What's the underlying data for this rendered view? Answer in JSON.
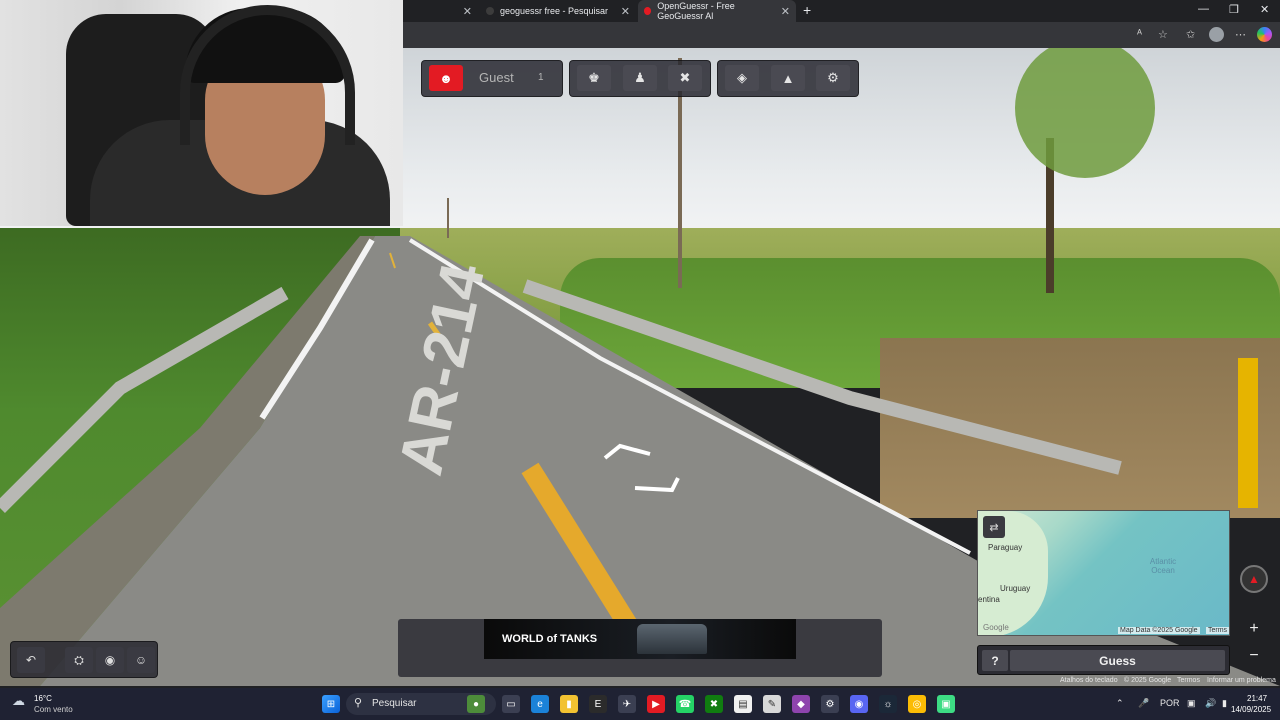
{
  "browser": {
    "tabs": [
      {
        "label": "",
        "close": "✕"
      },
      {
        "label": "geoguessr free - Pesquisar",
        "close": "✕"
      },
      {
        "label": "OpenGuessr - Free GeoGuessr Al",
        "close": "✕"
      }
    ],
    "new_tab": "+",
    "window_controls": {
      "minimize": "—",
      "maximize": "❐",
      "close": "✕"
    }
  },
  "game": {
    "player_name": "Guest",
    "player_count": "1",
    "guess_help": "?",
    "guess_label": "Guess",
    "road_marking": "AR-214",
    "map_labels": {
      "paraguay": "Paraguay",
      "uruguay": "Uruguay",
      "argentina": "entina",
      "ocean": "Atlantic Ocean",
      "attribution": "Map Data ©2025 Google",
      "terms": "Terms",
      "google": "Google"
    },
    "credits": {
      "shortcuts": "Atalhos do teclado",
      "data": "© 2025 Google",
      "terms": "Termos",
      "report": "Informar um problema"
    },
    "zoom_in": "+",
    "zoom_out": "−",
    "ad_label": "WORLD of TANKS"
  },
  "taskbar": {
    "weather_temp": "16°C",
    "weather_cond": "Com vento",
    "search_label": "Pesquisar",
    "language": "POR",
    "time": "21:47",
    "date": "14/09/2025"
  },
  "colors": {
    "accent_red": "#e31b23",
    "panel_bg": "#2c2c33",
    "taskbar_bg": "#1f2233"
  }
}
